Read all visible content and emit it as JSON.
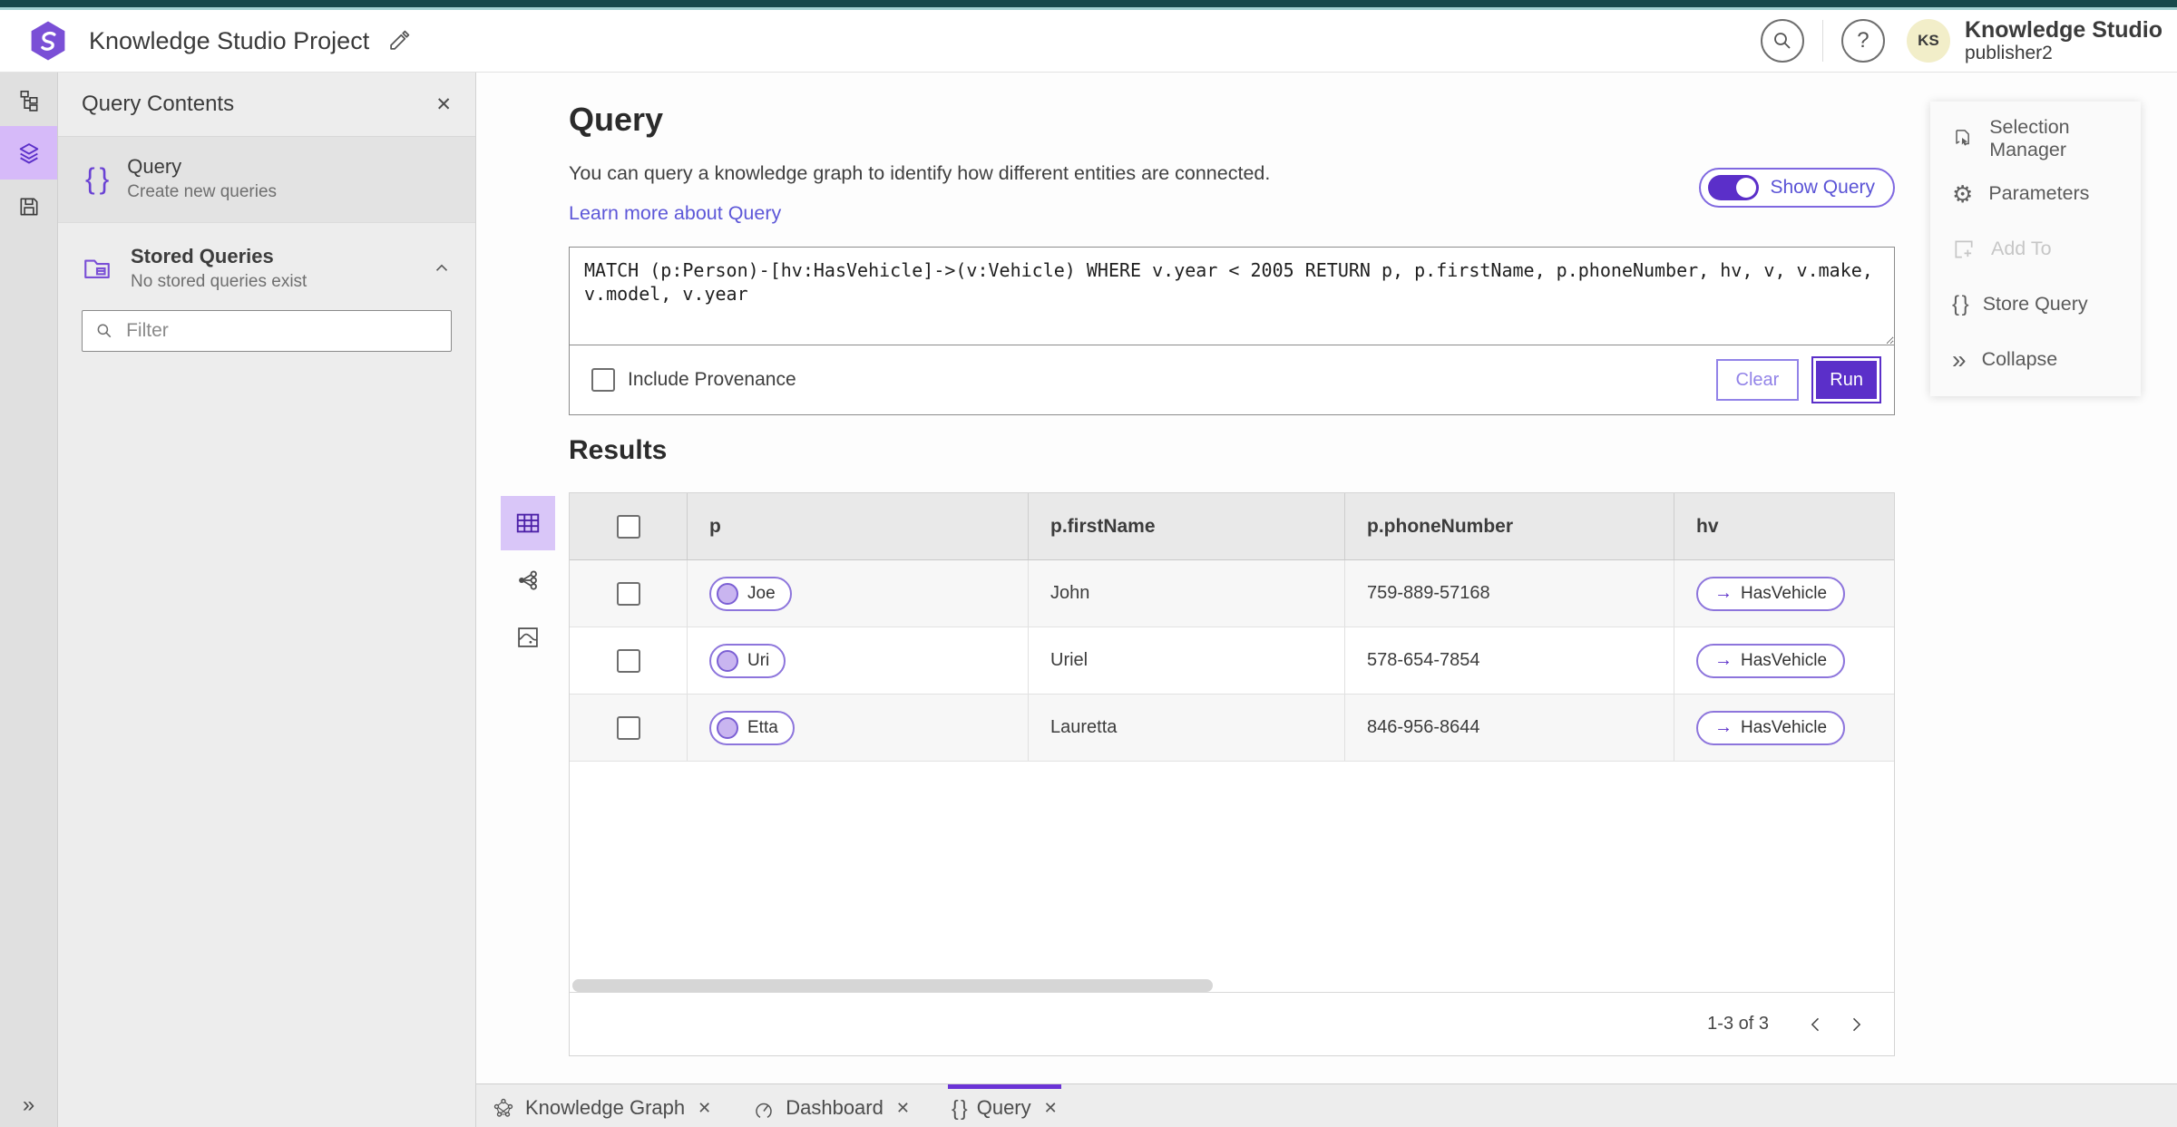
{
  "header": {
    "product_title": "Knowledge Studio Project",
    "account_name": "Knowledge Studio",
    "account_role": "publisher2",
    "avatar_initials": "KS"
  },
  "contents_panel": {
    "title": "Query Contents",
    "query_item": {
      "label": "Query",
      "description": "Create new queries"
    },
    "stored_queries": {
      "label": "Stored Queries",
      "description": "No stored queries exist"
    },
    "filter_placeholder": "Filter"
  },
  "query_panel": {
    "heading": "Query",
    "description": "You can query a knowledge graph to identify how different entities are connected.",
    "learn_more_link": "Learn more about Query",
    "show_query_label": "Show Query",
    "query_text": "MATCH (p:Person)-[hv:HasVehicle]->(v:Vehicle) WHERE v.year < 2005 RETURN p, p.firstName, p.phoneNumber, hv, v, v.make, v.model, v.year",
    "include_provenance_label": "Include Provenance",
    "clear_button": "Clear",
    "run_button": "Run"
  },
  "actions_panel": {
    "items": [
      {
        "label": "Selection Manager"
      },
      {
        "label": "Parameters"
      },
      {
        "label": "Add To"
      },
      {
        "label": "Store Query"
      },
      {
        "label": "Collapse"
      }
    ]
  },
  "results": {
    "heading": "Results",
    "columns": [
      "p",
      "p.firstName",
      "p.phoneNumber",
      "hv"
    ],
    "rows": [
      {
        "p": "Joe",
        "firstName": "John",
        "phoneNumber": "759-889-57168",
        "hv": "HasVehicle"
      },
      {
        "p": "Uri",
        "firstName": "Uriel",
        "phoneNumber": "578-654-7854",
        "hv": "HasVehicle"
      },
      {
        "p": "Etta",
        "firstName": "Lauretta",
        "phoneNumber": "846-956-8644",
        "hv": "HasVehicle"
      }
    ],
    "pagination": "1-3 of 3"
  },
  "bottom_tabs": [
    {
      "label": "Knowledge Graph"
    },
    {
      "label": "Dashboard"
    },
    {
      "label": "Query"
    }
  ],
  "glyphs": {
    "braces": "{ }",
    "arrow_right": "→",
    "question_mark": "?",
    "double_chevron_right": "»",
    "close": "✕"
  },
  "colors": {
    "accent": "#5b2fc9",
    "accent_light": "#7f68e0",
    "link": "#5d57d8",
    "teal_dark": "#17494b",
    "teal_light": "#a3d2d2"
  }
}
